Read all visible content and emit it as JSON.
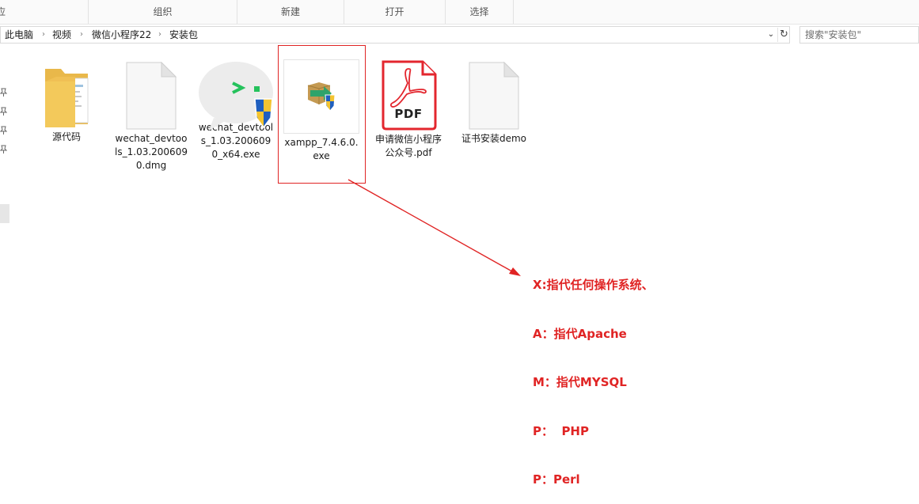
{
  "ribbon": {
    "groups": [
      "组织",
      "新建",
      "打开",
      "选择"
    ],
    "left_fragment": "应"
  },
  "address": {
    "crumbs": [
      "此电脑",
      "视频",
      "微信小程序22",
      "安装包"
    ]
  },
  "search": {
    "placeholder": "搜索\"安装包\""
  },
  "files": [
    {
      "name": "源代码",
      "icon": "folder-icon"
    },
    {
      "name": "wechat_devtools_1.03.2006090.dmg",
      "icon": "blank-document-icon"
    },
    {
      "name": "wechat_devtools_1.03.2006090_x64.exe",
      "icon": "wechat-devtools-installer-icon"
    },
    {
      "name": "xampp_7.4.6.0.exe",
      "icon": "xampp-installer-icon"
    },
    {
      "name": "申请微信小程序公众号.pdf",
      "icon": "pdf-icon"
    },
    {
      "name": "证书安装demo",
      "icon": "blank-document-icon"
    }
  ],
  "annotation": {
    "lines": [
      "X:指代任何操作系统、",
      "A：指代Apache",
      "M：指代MYSQL",
      "P：  PHP",
      "P：Perl"
    ],
    "color": "#e02424"
  },
  "pdf_badge": "PDF"
}
